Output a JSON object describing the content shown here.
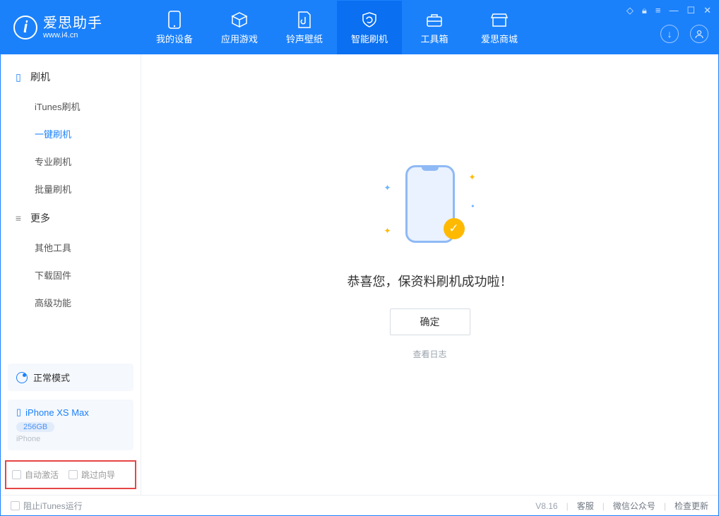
{
  "app": {
    "title": "爱思助手",
    "subtitle": "www.i4.cn"
  },
  "nav": {
    "items": [
      {
        "label": "我的设备"
      },
      {
        "label": "应用游戏"
      },
      {
        "label": "铃声壁纸"
      },
      {
        "label": "智能刷机"
      },
      {
        "label": "工具箱"
      },
      {
        "label": "爱思商城"
      }
    ]
  },
  "sidebar": {
    "group1": {
      "title": "刷机",
      "items": [
        {
          "label": "iTunes刷机"
        },
        {
          "label": "一键刷机"
        },
        {
          "label": "专业刷机"
        },
        {
          "label": "批量刷机"
        }
      ]
    },
    "group2": {
      "title": "更多",
      "items": [
        {
          "label": "其他工具"
        },
        {
          "label": "下载固件"
        },
        {
          "label": "高级功能"
        }
      ]
    },
    "mode": {
      "label": "正常模式"
    },
    "device": {
      "name": "iPhone XS Max",
      "capacity": "256GB",
      "type": "iPhone"
    },
    "checks": {
      "auto_activate": "自动激活",
      "skip_guide": "跳过向导"
    }
  },
  "main": {
    "success_text": "恭喜您，保资料刷机成功啦！",
    "ok_button": "确定",
    "view_log": "查看日志"
  },
  "statusbar": {
    "block_itunes": "阻止iTunes运行",
    "version": "V8.16",
    "cs": "客服",
    "wechat": "微信公众号",
    "update": "检查更新"
  }
}
